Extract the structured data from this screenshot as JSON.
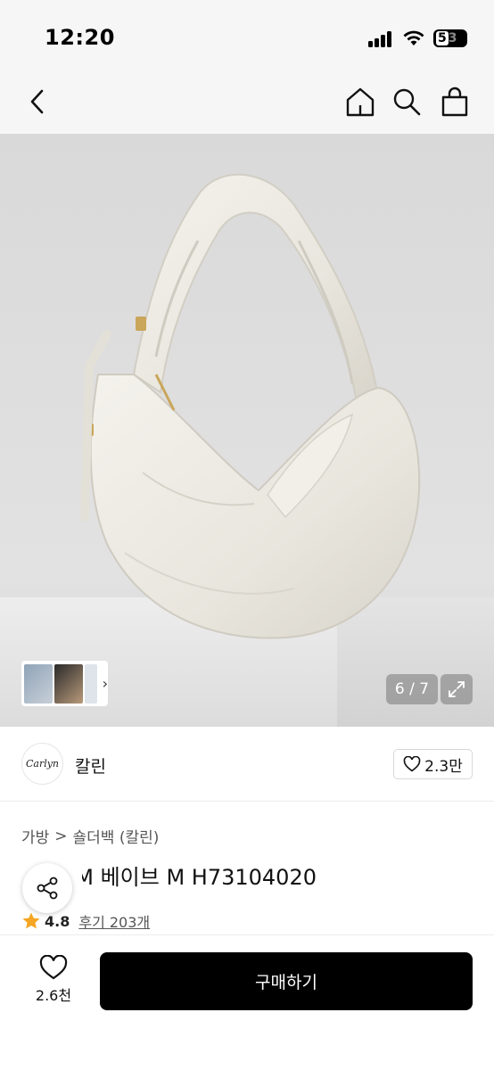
{
  "status_bar": {
    "time": "12:20",
    "battery_level": "5",
    "battery_suffix": "3"
  },
  "nav": {
    "back_icon": "chevron-left-icon",
    "home_icon": "home-icon",
    "search_icon": "search-icon",
    "cart_icon": "shopping-bag-icon"
  },
  "gallery": {
    "page_counter": "6 / 7",
    "thumb_chevron": "›"
  },
  "brand": {
    "logo_text": "Carlyn",
    "name": "칼린",
    "like_count": "2.3만"
  },
  "breadcrumb": {
    "category": "가방",
    "separator": ">",
    "subcategory": "숄더백 (칼린)"
  },
  "product": {
    "title": "Bale M 베이브 M H73104020",
    "rating": "4.8",
    "reviews": "후기 203개"
  },
  "bottom_bar": {
    "wish_count": "2.6천",
    "buy_label": "구매하기"
  },
  "colors": {
    "primary_button": "#000000",
    "rating_star": "#f5a623",
    "bag": "#ece9e1"
  }
}
